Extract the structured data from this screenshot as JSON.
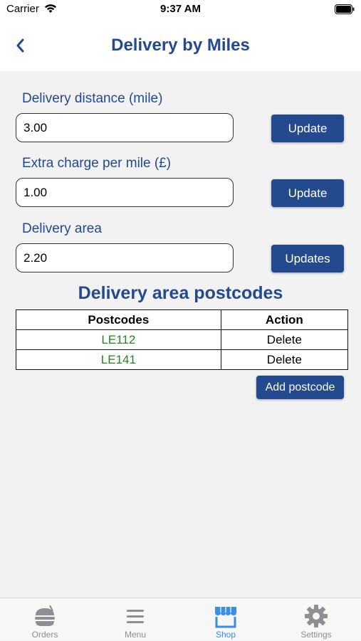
{
  "status_bar": {
    "carrier": "Carrier",
    "time": "9:37 AM"
  },
  "nav": {
    "title": "Delivery by Miles",
    "back_icon": "chevron-left-icon"
  },
  "form": {
    "distance": {
      "label": "Delivery distance (mile)",
      "value": "3.00",
      "button": "Update"
    },
    "extra_charge": {
      "label": "Extra charge per mile (£)",
      "value": "1.00",
      "button": "Update"
    },
    "area": {
      "label": "Delivery area",
      "value": "2.20",
      "button": "Updates"
    }
  },
  "postcodes_section": {
    "title": "Delivery area postcodes",
    "columns": [
      "Postcodes",
      "Action"
    ],
    "rows": [
      {
        "postcode": "LE112",
        "action": "Delete"
      },
      {
        "postcode": "LE141",
        "action": "Delete"
      }
    ],
    "add_button": "Add postcode"
  },
  "tab_bar": {
    "tabs": [
      {
        "label": "Orders",
        "icon": "burger-icon",
        "active": false
      },
      {
        "label": "Menu",
        "icon": "menu-lines-icon",
        "active": false
      },
      {
        "label": "Shop",
        "icon": "shop-icon",
        "active": true
      },
      {
        "label": "Settings",
        "icon": "gear-icon",
        "active": false
      }
    ]
  },
  "colors": {
    "accent": "#23498f",
    "postcode_text": "#1e8a1e",
    "active_tab": "#3a8ee6",
    "inactive_tab": "#8e8e93",
    "background": "#f2f2f2"
  }
}
